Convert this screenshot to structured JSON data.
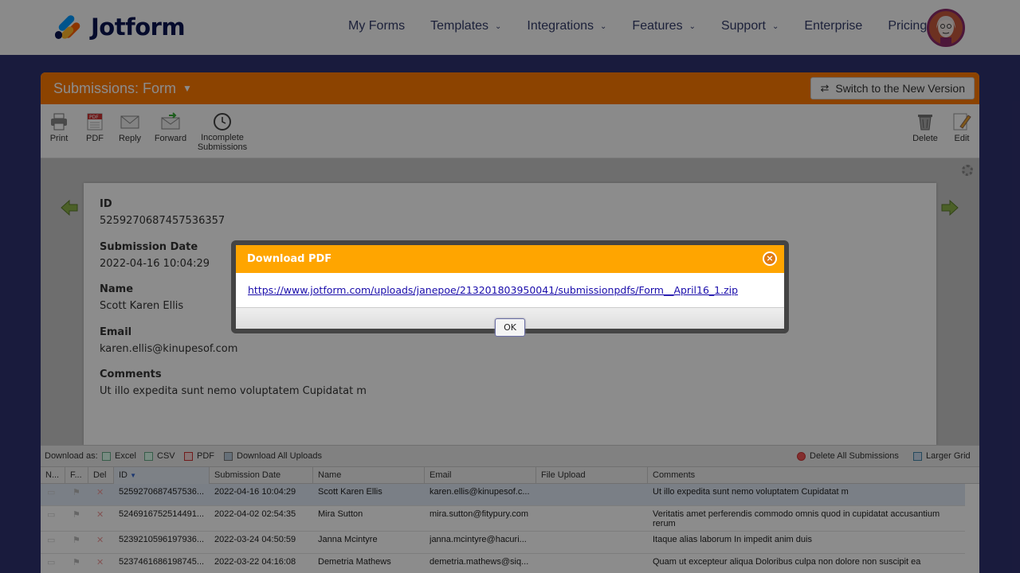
{
  "brand": {
    "name": "Jotform"
  },
  "nav": [
    {
      "label": "My Forms",
      "has_menu": false
    },
    {
      "label": "Templates",
      "has_menu": true
    },
    {
      "label": "Integrations",
      "has_menu": true
    },
    {
      "label": "Features",
      "has_menu": true
    },
    {
      "label": "Support",
      "has_menu": true
    },
    {
      "label": "Enterprise",
      "has_menu": false
    },
    {
      "label": "Pricing",
      "has_menu": false
    }
  ],
  "panel": {
    "title": "Submissions: Form",
    "switch_label": "Switch to the New Version"
  },
  "toolbar": {
    "print": "Print",
    "pdf": "PDF",
    "reply": "Reply",
    "forward": "Forward",
    "incomplete_1": "Incomplete",
    "incomplete_2": "Submissions",
    "delete": "Delete",
    "edit": "Edit"
  },
  "submission": {
    "id_label": "ID",
    "id_value": "5259270687457536357",
    "date_label": "Submission Date",
    "date_value": "2022-04-16 10:04:29",
    "name_label": "Name",
    "name_value": "Scott Karen Ellis",
    "email_label": "Email",
    "email_value": "karen.ellis@kinupesof.com",
    "comments_label": "Comments",
    "comments_value": "Ut illo expedita sunt nemo voluptatem Cupidatat m"
  },
  "download_bar": {
    "download_as": "Download as:",
    "excel": "Excel",
    "csv": "CSV",
    "pdf": "PDF",
    "all_uploads": "Download All Uploads",
    "delete_all": "Delete All Submissions",
    "larger_grid": "Larger Grid"
  },
  "grid": {
    "columns": [
      "N...",
      "F...",
      "Del",
      "ID",
      "Submission Date",
      "Name",
      "Email",
      "File Upload",
      "Comments"
    ],
    "rows": [
      {
        "id": "5259270687457536...",
        "date": "2022-04-16 10:04:29",
        "name": "Scott Karen Ellis",
        "email": "karen.ellis@kinupesof.c...",
        "comments": "Ut illo expedita sunt nemo voluptatem Cupidatat m"
      },
      {
        "id": "5246916752514491...",
        "date": "2022-04-02 02:54:35",
        "name": "Mira Sutton",
        "email": "mira.sutton@fitypury.com",
        "comments": "Veritatis amet perferendis commodo omnis quod in cupidatat accusantium rerum"
      },
      {
        "id": "5239210596197936...",
        "date": "2022-03-24 04:50:59",
        "name": "Janna Mcintyre",
        "email": "janna.mcintyre@hacuri...",
        "comments": "Itaque alias laborum In impedit anim duis"
      },
      {
        "id": "5237461686198745...",
        "date": "2022-03-22 04:16:08",
        "name": "Demetria Mathews",
        "email": "demetria.mathews@siq...",
        "comments": "Quam ut excepteur aliqua Doloribus culpa non dolore non suscipit ea"
      }
    ]
  },
  "dialog": {
    "title": "Download PDF",
    "close_glyph": "×",
    "link": "https://www.jotform.com/uploads/janepoe/213201803950041/submissionpdfs/Form__April16_1.zip",
    "ok_label": "OK"
  },
  "colors": {
    "brand_navy": "#0a1551",
    "panel_orange": "#ff7a00",
    "dialog_orange": "#ffa500",
    "page_bg": "#2f3270"
  }
}
